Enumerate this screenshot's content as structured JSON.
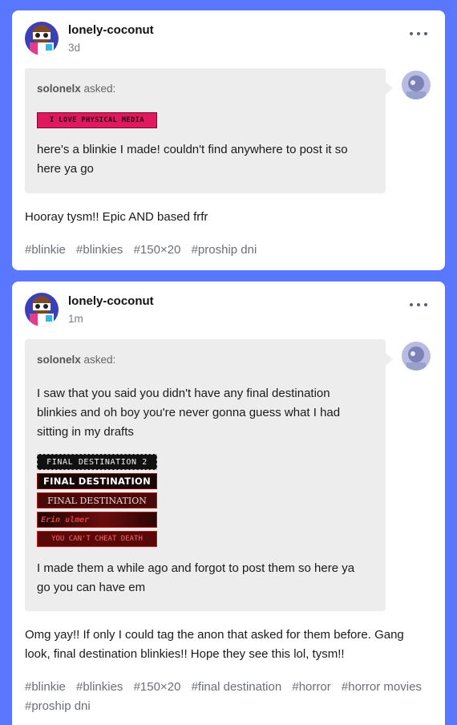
{
  "posts": [
    {
      "username": "lonely-coconut",
      "time": "3d",
      "ask": {
        "asker": "solonelx",
        "asked_label": "asked:",
        "text": "here's a blinkie I made! couldn't find anywhere to post it so here ya go",
        "blinkies": [
          "I LOVE PHYSICAL MEDIA"
        ]
      },
      "reply": "Hooray tysm!! Epic AND based frfr",
      "tags": [
        "#blinkie",
        "#blinkies",
        "#150×20",
        "#proship dni"
      ]
    },
    {
      "username": "lonely-coconut",
      "time": "1m",
      "ask": {
        "asker": "solonelx",
        "asked_label": "asked:",
        "text": "I saw that you said you didn't have any final destination blinkies and oh boy you're never gonna guess what I had sitting in my drafts",
        "blinkies": [
          "FINAL DESTINATION 2",
          "FINAL DESTINATION",
          "FINAL DESTINATION",
          "Erin ulmer",
          "YOU CAN'T CHEAT DEATH"
        ],
        "text2": "I made them a while ago and forgot to post them so here ya go you can have em"
      },
      "reply": "Omg yay!! If only I could tag the anon that asked for them before. Gang look, final destination blinkies!! Hope they see this lol, tysm!!",
      "tags": [
        "#blinkie",
        "#blinkies",
        "#150×20",
        "#final destination",
        "#horror",
        "#horror movies",
        "#proship dni"
      ]
    }
  ],
  "icons": {
    "more": "more-options-icon",
    "avatar": "user-avatar",
    "asker_avatar": "asker-avatar"
  },
  "colors": {
    "background": "#5a78ff",
    "card": "#ffffff",
    "ask_box": "#ededed",
    "tag_text": "#6b6f75",
    "blinkie_pink": "#e0185e"
  }
}
